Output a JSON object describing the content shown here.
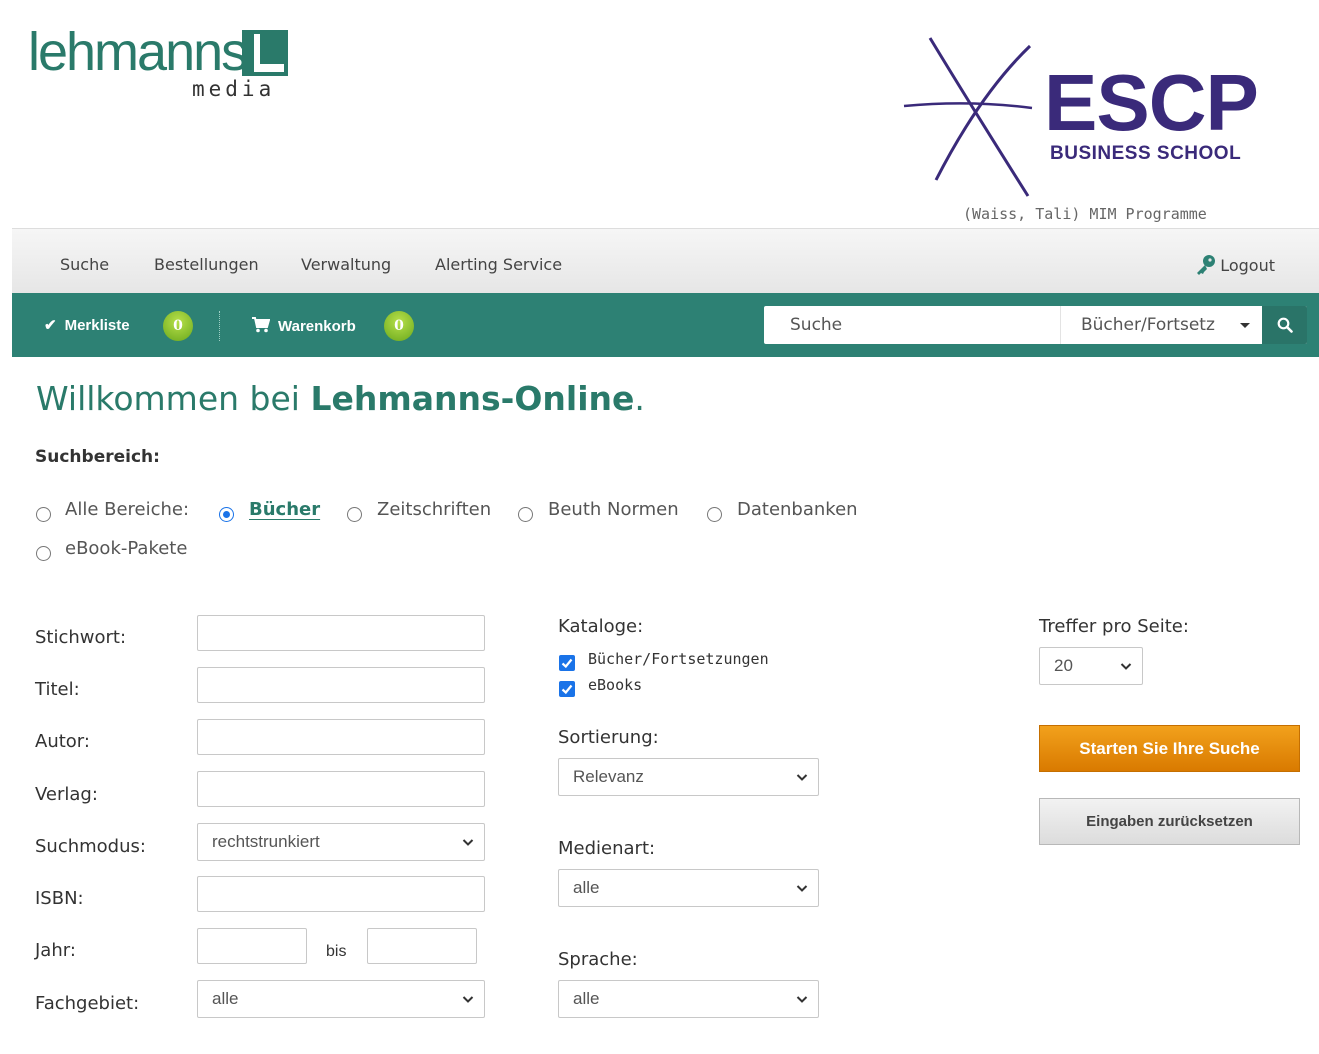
{
  "header": {
    "lehmanns_logo_text": "lehmanns",
    "lehmanns_logo_sub": "media",
    "escp_logo_text": "ESCP",
    "escp_logo_sub": "BUSINESS SCHOOL",
    "user_line": "(Waiss, Tali) MIM Programme"
  },
  "top_nav": {
    "items": [
      "Suche",
      "Bestellungen",
      "Verwaltung",
      "Alerting Service"
    ],
    "logout_label": "Logout",
    "logout_icon": "key-icon"
  },
  "action_bar": {
    "merkliste_label": "Merkliste",
    "merkliste_count": "0",
    "warenkorb_label": "Warenkorb",
    "warenkorb_count": "0",
    "search_placeholder": "Suche",
    "catalog_selected": "Bücher/Fortsetz",
    "search_button_icon": "search-icon"
  },
  "welcome": {
    "prefix": "Willkommen bei ",
    "brand": "Lehmanns-Online",
    "suffix": "."
  },
  "suchbereich": {
    "label": "Suchbereich:",
    "options": [
      {
        "label": "Alle Bereiche:",
        "checked": false
      },
      {
        "label": "Bücher",
        "checked": true
      },
      {
        "label": "Zeitschriften",
        "checked": false
      },
      {
        "label": "Beuth Normen",
        "checked": false
      },
      {
        "label": "Datenbanken",
        "checked": false
      },
      {
        "label": "eBook-Pakete",
        "checked": false
      }
    ]
  },
  "form": {
    "stichwort_label": "Stichwort:",
    "titel_label": "Titel:",
    "autor_label": "Autor:",
    "verlag_label": "Verlag:",
    "suchmodus_label": "Suchmodus:",
    "suchmodus_value": "rechtstrunkiert",
    "isbn_label": "ISBN:",
    "jahr_label": "Jahr:",
    "jahr_bis": "bis",
    "fachgebiet_label": "Fachgebiet:",
    "fachgebiet_value": "alle"
  },
  "middle": {
    "kataloge_label": "Kataloge:",
    "kataloge": [
      {
        "label": "Bücher/Fortsetzungen",
        "checked": true
      },
      {
        "label": "eBooks",
        "checked": true
      }
    ],
    "sortierung_label": "Sortierung:",
    "sortierung_value": "Relevanz",
    "medienart_label": "Medienart:",
    "medienart_value": "alle",
    "sprache_label": "Sprache:",
    "sprache_value": "alle"
  },
  "right": {
    "treffer_label": "Treffer pro Seite:",
    "treffer_value": "20",
    "start_button": "Starten Sie Ihre Suche",
    "reset_button": "Eingaben zurücksetzen"
  },
  "colors": {
    "brand_green": "#2d8174",
    "escp_purple": "#3a2a7a",
    "start_orange": "#e88d0c",
    "badge_green": "#8cc63f"
  }
}
